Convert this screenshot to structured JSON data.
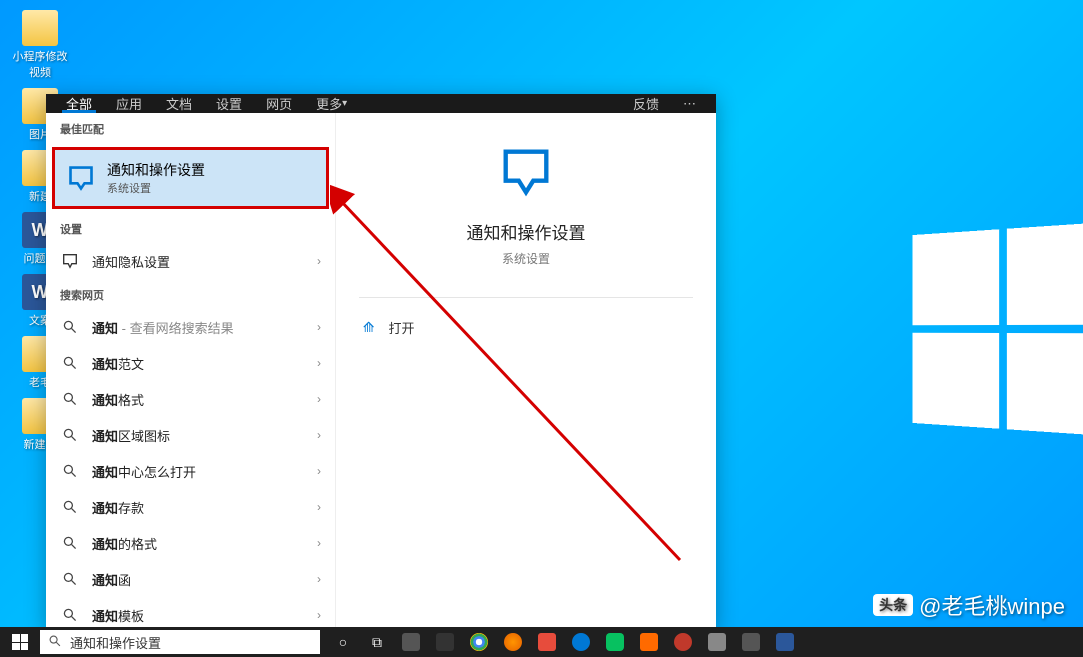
{
  "desktop": {
    "icons": [
      {
        "label": "小程序修改视频",
        "type": "folder"
      },
      {
        "label": "图片",
        "type": "folder"
      },
      {
        "label": "新建",
        "type": "folder"
      },
      {
        "label": "问题及",
        "type": "word"
      },
      {
        "label": "文案",
        "type": "word"
      },
      {
        "label": "老毛",
        "type": "folder"
      },
      {
        "label": "新建文",
        "type": "folder"
      }
    ]
  },
  "tabs": {
    "items": [
      "全部",
      "应用",
      "文档",
      "设置",
      "网页",
      "更多"
    ],
    "active": 0,
    "feedback": "反馈"
  },
  "sections": {
    "best_match_header": "最佳匹配",
    "settings_header": "设置",
    "search_web_header": "搜索网页"
  },
  "best_match": {
    "title": "通知和操作设置",
    "subtitle": "系统设置"
  },
  "settings_rows": [
    {
      "label": "通知隐私设置"
    }
  ],
  "web_rows": [
    {
      "prefix": "通知",
      "suffix": " - 查看网络搜索结果"
    },
    {
      "prefix": "通知",
      "suffix": "范文"
    },
    {
      "prefix": "通知",
      "suffix": "格式"
    },
    {
      "prefix": "通知",
      "suffix": "区域图标"
    },
    {
      "prefix": "通知",
      "suffix": "中心怎么打开"
    },
    {
      "prefix": "通知",
      "suffix": "存款"
    },
    {
      "prefix": "通知",
      "suffix": "的格式"
    },
    {
      "prefix": "通知",
      "suffix": "函"
    },
    {
      "prefix": "通知",
      "suffix": "模板"
    }
  ],
  "preview": {
    "title": "通知和操作设置",
    "subtitle": "系统设置",
    "open_label": "打开"
  },
  "searchbox": {
    "value": "通知和操作设置"
  },
  "watermark": {
    "badge": "头条",
    "text": "@老毛桃winpe"
  }
}
